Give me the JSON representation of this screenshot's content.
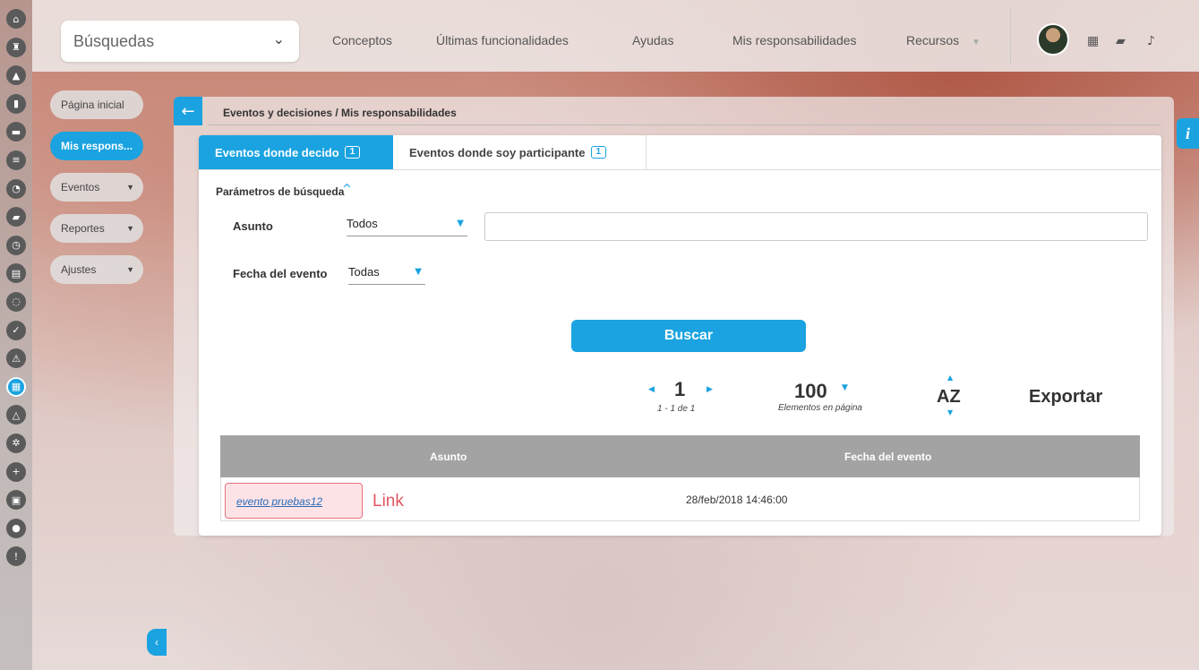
{
  "rail_icons": [
    "home-icon",
    "castle-icon",
    "triangle-icon",
    "bar-chart-icon",
    "monitor-icon",
    "list-icon",
    "pie-chart-icon",
    "folder-icon",
    "clock-icon",
    "document-icon",
    "cycle-icon",
    "check-icon",
    "warning-icon",
    "calendar-icon",
    "network-icon",
    "gear-icon",
    "plus-icon",
    "briefcase-icon",
    "settings-icon",
    "alert-icon"
  ],
  "topbar": {
    "search_label": "Búsquedas",
    "nav": {
      "conceptos": "Conceptos",
      "ultimas": "Últimas funcionalidades",
      "ayudas": "Ayudas",
      "mis_resp": "Mis responsabilidades",
      "recursos": "Recursos"
    }
  },
  "subnav": {
    "pagina_inicial": "Página inicial",
    "mis_respons": "Mis respons...",
    "eventos": "Eventos",
    "reportes": "Reportes",
    "ajustes": "Ajustes"
  },
  "info_tab": "i",
  "breadcrumb": "Eventos y decisiones / Mis responsabilidades",
  "tabs": {
    "decido_label": "Eventos donde decido",
    "decido_count": "1",
    "participante_label": "Eventos donde soy participante",
    "participante_count": "1"
  },
  "params": {
    "title": "Parámetros de búsqueda",
    "asunto_label": "Asunto",
    "asunto_value": "Todos",
    "fecha_label": "Fecha del evento",
    "fecha_value": "Todas"
  },
  "buscar_label": "Buscar",
  "pager": {
    "page": "1",
    "range": "1 - 1 de 1",
    "per_page": "100",
    "per_page_label": "Elementos en página",
    "sort_label": "AZ",
    "export_label": "Exportar"
  },
  "table": {
    "headers": [
      "Asunto",
      "Fecha del evento"
    ],
    "rows": [
      {
        "asunto": "evento pruebas12",
        "fecha": "28/feb/2018 14:46:00"
      }
    ]
  },
  "annotation": "Link",
  "colors": {
    "accent": "#1aa3e0",
    "annotation": "#e0555f"
  }
}
